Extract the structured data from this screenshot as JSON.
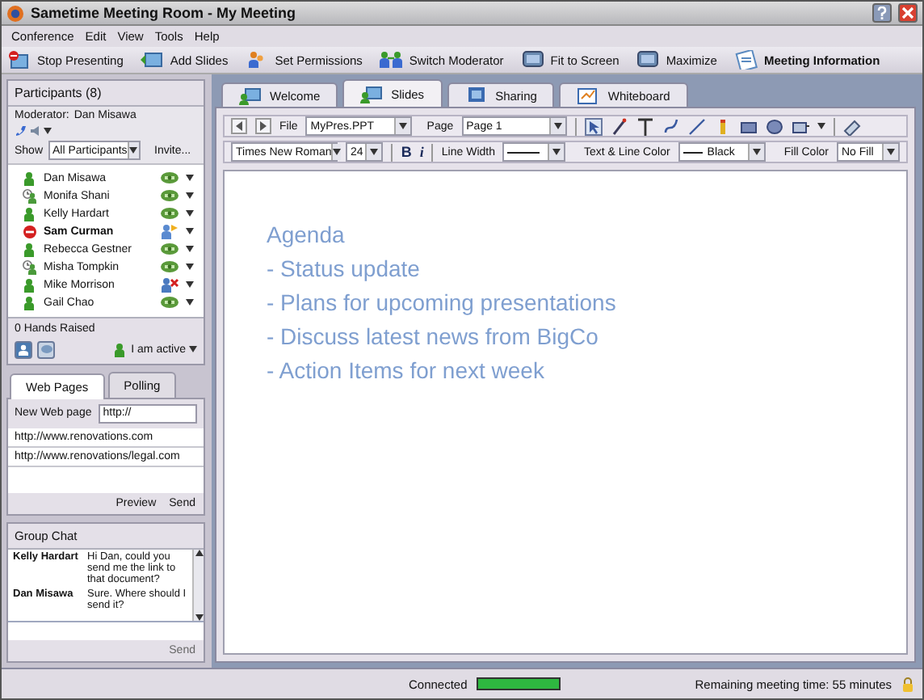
{
  "window": {
    "title": "Sametime Meeting Room - My Meeting"
  },
  "menu": [
    "Conference",
    "Edit",
    "View",
    "Tools",
    "Help"
  ],
  "toolbar": [
    {
      "label": "Stop Presenting",
      "kind": "stop",
      "bold": false
    },
    {
      "label": "Add Slides",
      "kind": "slides",
      "bold": false
    },
    {
      "label": "Set Permissions",
      "kind": "people",
      "bold": false
    },
    {
      "label": "Switch Moderator",
      "kind": "switch",
      "bold": false
    },
    {
      "label": "Fit to Screen",
      "kind": "monitor",
      "bold": false
    },
    {
      "label": "Maximize",
      "kind": "monitor",
      "bold": false
    },
    {
      "label": "Meeting Information",
      "kind": "info",
      "bold": true
    }
  ],
  "participants": {
    "title": "Participants (8)",
    "moderator_label": "Moderator:",
    "moderator": "Dan Misawa",
    "show_label": "Show",
    "filter": "All Participants",
    "invite": "Invite...",
    "list": [
      {
        "name": "Dan Misawa",
        "away": false,
        "do_not_disturb": false,
        "presenting": false,
        "muted": false
      },
      {
        "name": "Monifa Shani",
        "away": true,
        "do_not_disturb": false,
        "presenting": false,
        "muted": false
      },
      {
        "name": "Kelly Hardart",
        "away": false,
        "do_not_disturb": false,
        "presenting": false,
        "muted": false
      },
      {
        "name": "Sam Curman",
        "away": false,
        "do_not_disturb": true,
        "presenting": true,
        "muted": false
      },
      {
        "name": "Rebecca Gestner",
        "away": false,
        "do_not_disturb": false,
        "presenting": false,
        "muted": false
      },
      {
        "name": "Misha Tompkin",
        "away": true,
        "do_not_disturb": false,
        "presenting": false,
        "muted": false
      },
      {
        "name": "Mike Morrison",
        "away": false,
        "do_not_disturb": false,
        "presenting": false,
        "muted": true
      },
      {
        "name": "Gail Chao",
        "away": false,
        "do_not_disturb": false,
        "presenting": false,
        "muted": false
      }
    ],
    "hands": "0 Hands Raised",
    "my_status": "I am active"
  },
  "web_pages": {
    "tabs": [
      {
        "label": "Web Pages",
        "selected": true
      },
      {
        "label": "Polling",
        "selected": false
      }
    ],
    "new_label": "New Web page",
    "url_value": "http://",
    "urls": [
      "http://www.renovations.com",
      "http://www.renovations/legal.com"
    ],
    "buttons": [
      "Preview",
      "Send"
    ]
  },
  "chat": {
    "title": "Group Chat",
    "messages": [
      {
        "sender": "Kelly Hardart",
        "text": "Hi Dan, could you send me the link to that document?"
      },
      {
        "sender": "Dan Misawa",
        "text": "Sure. Where should I send it?"
      }
    ],
    "send": "Send"
  },
  "tabs": [
    {
      "label": "Welcome",
      "kind": "welcome",
      "selected": false
    },
    {
      "label": "Slides",
      "kind": "welcome",
      "selected": true
    },
    {
      "label": "Sharing",
      "kind": "screen",
      "selected": false
    },
    {
      "label": "Whiteboard",
      "kind": "board",
      "selected": false
    }
  ],
  "slide_toolbar": {
    "file_label": "File",
    "file": "MyPres.PPT",
    "page_label": "Page",
    "page": "Page 1",
    "font": "Times New Roman",
    "size": "24",
    "bold": "B",
    "italic": "i",
    "line_width_label": "Line Width",
    "line_color_label": "Text & Line Color",
    "line_color": "Black",
    "fill_label": "Fill Color",
    "fill": "No Fill"
  },
  "slide": {
    "lines": [
      "Agenda",
      "- Status update",
      "- Plans for upcoming presentations",
      "- Discuss latest news from BigCo",
      "- Action Items for next week"
    ]
  },
  "status_bar": {
    "connection": "Connected",
    "level": 1,
    "remaining": "Remaining meeting time: 55 minutes"
  }
}
